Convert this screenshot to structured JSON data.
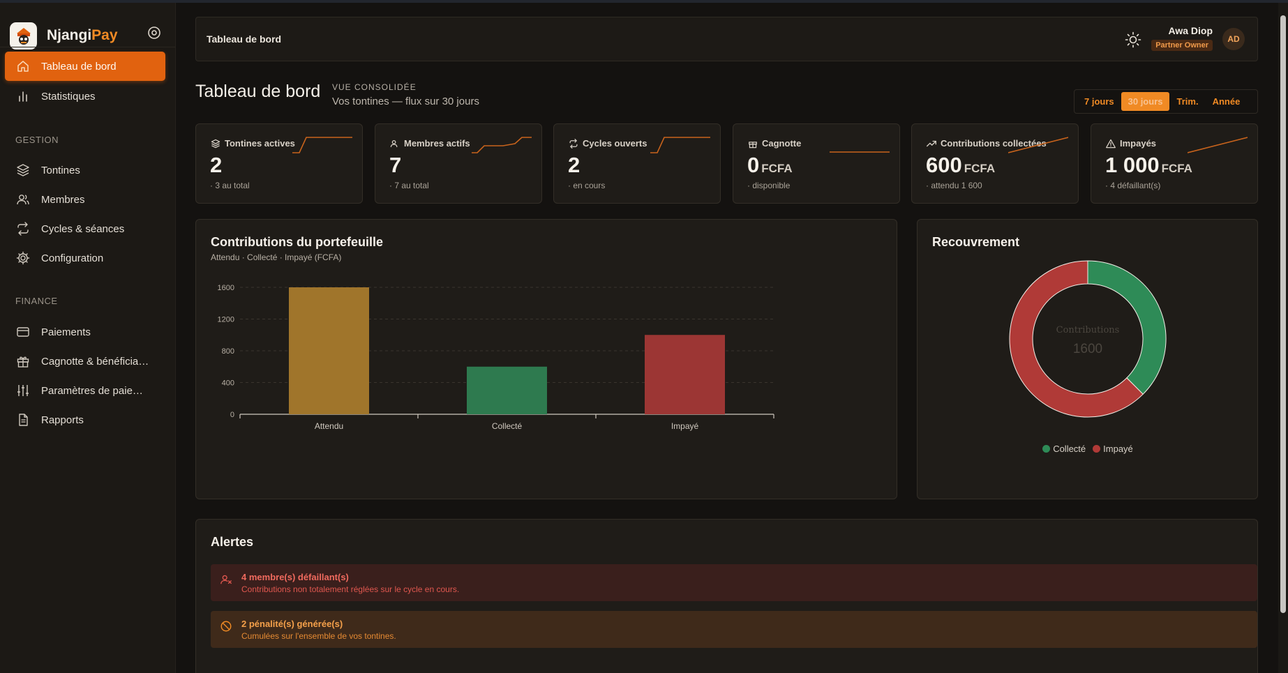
{
  "app": {
    "brand_main": "Njangi",
    "brand_accent": "Pay"
  },
  "sidebar": {
    "items_top": [
      {
        "label": "Tableau de bord",
        "icon": "home-icon",
        "active": true
      },
      {
        "label": "Statistiques",
        "icon": "bar-chart-icon",
        "active": false
      }
    ],
    "section_gestion": "GESTION",
    "items_gestion": [
      {
        "label": "Tontines",
        "icon": "layers-icon"
      },
      {
        "label": "Membres",
        "icon": "users-icon"
      },
      {
        "label": "Cycles & séances",
        "icon": "repeat-icon"
      },
      {
        "label": "Configuration",
        "icon": "gear-icon"
      }
    ],
    "section_finance": "FINANCE",
    "items_finance": [
      {
        "label": "Paiements",
        "icon": "credit-card-icon"
      },
      {
        "label": "Cagnotte & bénéficia…",
        "icon": "gift-icon"
      },
      {
        "label": "Paramètres de paie…",
        "icon": "sliders-icon"
      },
      {
        "label": "Rapports",
        "icon": "document-icon"
      }
    ]
  },
  "header": {
    "breadcrumb": "Tableau de bord",
    "user_name": "Awa Diop",
    "user_role": "Partner Owner",
    "avatar_initials": "AD"
  },
  "page": {
    "title": "Tableau de bord",
    "eyebrow": "VUE CONSOLIDÉE",
    "subtitle": "Vos tontines — flux sur 30 jours",
    "ranges": [
      "7 jours",
      "30 jours",
      "Trim.",
      "Année"
    ],
    "selected_range": "30 jours"
  },
  "kpis": [
    {
      "title": "Tontines actives",
      "value": "2",
      "unit": "",
      "sub": "· 3 au total",
      "icon": "layers-icon"
    },
    {
      "title": "Membres actifs",
      "value": "7",
      "unit": "",
      "sub": "· 7 au total",
      "icon": "users-icon"
    },
    {
      "title": "Cycles ouverts",
      "value": "2",
      "unit": "",
      "sub": "· en cours",
      "icon": "repeat-icon"
    },
    {
      "title": "Cagnotte",
      "value": "0",
      "unit": "FCFA",
      "sub": "· disponible",
      "icon": "gift-icon"
    },
    {
      "title": "Contributions collectées",
      "value": "600",
      "unit": "FCFA",
      "sub": "· attendu 1 600",
      "icon": "trending-up-icon"
    },
    {
      "title": "Impayés",
      "value": "1 000",
      "unit": "FCFA",
      "sub": "· 4 défaillant(s)",
      "icon": "warning-icon"
    }
  ],
  "contributions_panel": {
    "title": "Contributions du portefeuille",
    "subtitle": "Attendu · Collecté · Impayé (FCFA)"
  },
  "recouvrement_panel": {
    "title": "Recouvrement",
    "center_label": "Contributions",
    "center_value": "1600",
    "legend": [
      {
        "label": "Collecté",
        "color": "#2e8b57"
      },
      {
        "label": "Impayé",
        "color": "#b03a37"
      }
    ]
  },
  "alerts": {
    "title": "Alertes",
    "items": [
      {
        "title": "4 membre(s) défaillant(s)",
        "desc": "Contributions non totalement réglées sur le cycle en cours.",
        "icon": "user-x-icon"
      },
      {
        "title": "2 pénalité(s) générée(s)",
        "desc": "Cumulées sur l'ensemble de vos tontines.",
        "icon": "ban-icon"
      }
    ]
  },
  "chart_data": [
    {
      "type": "bar",
      "title": "Contributions du portefeuille",
      "subtitle": "Attendu · Collecté · Impayé (FCFA)",
      "categories": [
        "Attendu",
        "Collecté",
        "Impayé"
      ],
      "values": [
        1600,
        600,
        1000
      ],
      "colors": [
        "#a0752b",
        "#2e7a4f",
        "#9c3634"
      ],
      "ylim": [
        0,
        1600
      ],
      "yticks": [
        0,
        400,
        800,
        1200,
        1600
      ],
      "grid": true,
      "xlabel": "",
      "ylabel": ""
    },
    {
      "type": "pie",
      "title": "Recouvrement",
      "categories": [
        "Collecté",
        "Impayé"
      ],
      "values": [
        600,
        1000
      ],
      "colors": [
        "#2e8b57",
        "#b03a37"
      ],
      "legend": "bottom"
    }
  ]
}
